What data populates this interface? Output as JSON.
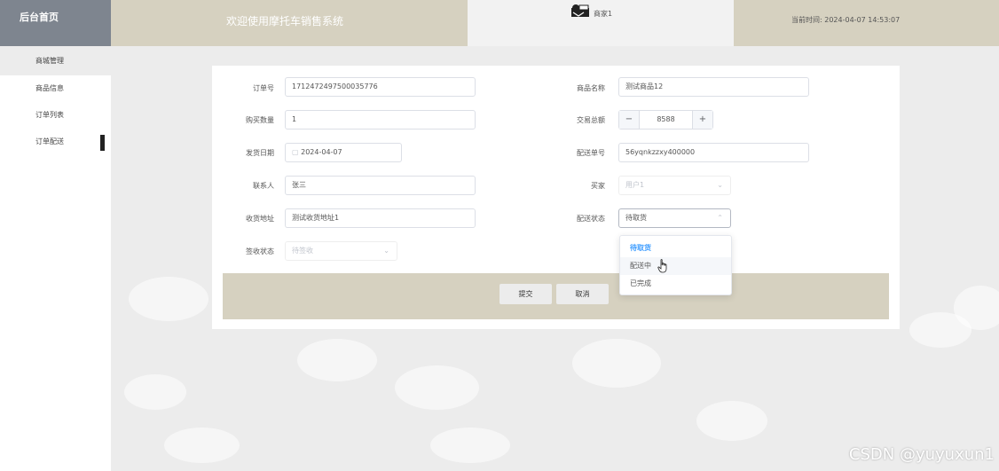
{
  "header": {
    "brand": "后台首页",
    "title": "欢迎使用摩托车销售系统",
    "user_name": "商家1",
    "time_label": "当前时间:",
    "time_value": "2024-04-07 14:53:07"
  },
  "sidebar": {
    "items": [
      {
        "label": "商城管理"
      },
      {
        "label": "商品信息"
      },
      {
        "label": "订单列表"
      },
      {
        "label": "订单配送"
      }
    ]
  },
  "form": {
    "order_no": {
      "label": "订单号",
      "value": "1712472497500035776"
    },
    "product_name": {
      "label": "商品名称",
      "value": "测试商品12"
    },
    "quantity": {
      "label": "购买数量",
      "value": "1"
    },
    "total": {
      "label": "交易总额",
      "value": "8588",
      "minus": "−",
      "plus": "+"
    },
    "ship_date": {
      "label": "发货日期",
      "value": "2024-04-07"
    },
    "delivery_no": {
      "label": "配送单号",
      "value": "56yqnkzzxy400000"
    },
    "contact": {
      "label": "联系人",
      "value": "张三"
    },
    "buyer": {
      "label": "买家",
      "value": "用户1"
    },
    "address": {
      "label": "收货地址",
      "value": "测试收货地址1"
    },
    "delivery_status": {
      "label": "配送状态",
      "value": "待取货"
    },
    "sign_status": {
      "label": "签收状态",
      "value": "待签收"
    }
  },
  "buttons": {
    "submit": "提交",
    "cancel": "取消"
  },
  "dropdown": {
    "options": [
      "待取货",
      "配送中",
      "已完成"
    ]
  },
  "watermark": "CSDN @yuyuxun1",
  "colors": {
    "header_dark": "#7e858f",
    "header_tan": "#d6d1c0",
    "accent": "#409eff"
  }
}
